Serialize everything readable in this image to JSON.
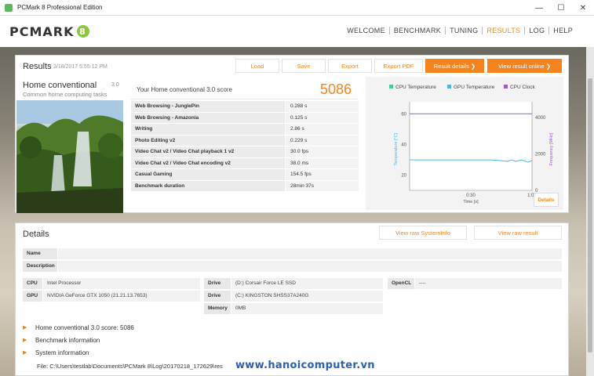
{
  "window": {
    "title": "PCMark 8 Professional Edition",
    "controls": [
      "—",
      "☐",
      "✕"
    ]
  },
  "header": {
    "logo_text": "PCMARK",
    "logo_badge": "8",
    "nav": [
      {
        "label": "WELCOME",
        "active": false
      },
      {
        "label": "BENCHMARK",
        "active": false
      },
      {
        "label": "TUNING",
        "active": false
      },
      {
        "label": "RESULTS",
        "active": true
      },
      {
        "label": "LOG",
        "active": false
      },
      {
        "label": "HELP",
        "active": false
      }
    ]
  },
  "results": {
    "title": "Results",
    "date": "2/18/2017 5:55:12 PM",
    "buttons": {
      "load": "Load",
      "save": "Save",
      "export": "Export",
      "export_pdf": "Export PDF",
      "result_details": "Result details ❯",
      "view_online": "View result online ❯"
    },
    "benchmark": {
      "name": "Home conventional",
      "version": "3.0",
      "subtitle": "Common home computing tasks"
    },
    "score": {
      "label": "Your Home conventional 3.0 score",
      "value": "5086"
    },
    "subscores": [
      {
        "name": "Web Browsing - JunglePin",
        "value": "0.288 s"
      },
      {
        "name": "Web Browsing - Amazonia",
        "value": "0.125 s"
      },
      {
        "name": "Writing",
        "value": "2.86 s"
      },
      {
        "name": "Photo Editing v2",
        "value": "0.229 s"
      },
      {
        "name": "Video Chat v2 / Video Chat playback 1 v2",
        "value": "30.0 fps"
      },
      {
        "name": "Video Chat v2 / Video Chat encoding v2",
        "value": "38.0 ms"
      },
      {
        "name": "Casual Gaming",
        "value": "154.5 fps"
      },
      {
        "name": "Benchmark duration",
        "value": "28min 37s"
      }
    ],
    "details_button": "Details"
  },
  "chart_data": {
    "type": "line",
    "legend_placement": "top",
    "xlabel": "Time [s]",
    "ylabel": "Temperature [°C]",
    "y2label": "Frequency [MHz]",
    "x_ticks": [
      "0:30",
      "1:00"
    ],
    "ylim": [
      10,
      65
    ],
    "y_ticks": [
      20,
      40,
      60
    ],
    "y2lim": [
      0,
      4600
    ],
    "y2_ticks": [
      0,
      2000,
      4000
    ],
    "grid": false,
    "colors": {
      "cpu_temp": "#48c7a3",
      "gpu_temp": "#4db6e6",
      "cpu_clock": "#9b59d0"
    },
    "series": [
      {
        "name": "CPU Temperature",
        "axis": "left",
        "x": [],
        "values": []
      },
      {
        "name": "GPU Temperature",
        "axis": "left",
        "x": [
          0,
          5,
          10,
          15,
          20,
          25,
          30,
          35,
          40,
          45,
          48,
          50,
          52,
          55,
          58,
          60
        ],
        "values": [
          30,
          30,
          30,
          30,
          30,
          30,
          30,
          30,
          30,
          29.5,
          29,
          30,
          29,
          30,
          28.5,
          29.5
        ]
      },
      {
        "name": "CPU Clock",
        "axis": "right",
        "x": [
          0,
          10,
          20,
          30,
          40,
          50,
          60
        ],
        "values": [
          4200,
          4200,
          4200,
          4200,
          4200,
          4200,
          4200
        ]
      }
    ]
  },
  "details": {
    "title": "Details",
    "view_systeminfo": "View raw SystemInfo",
    "view_result": "View raw result",
    "name_label": "Name",
    "name_value": "",
    "description_label": "Description",
    "description_value": "",
    "cpu_label": "CPU",
    "cpu_value": "Intel Processor",
    "gpu_label": "GPU",
    "gpu_value": "NVIDIA GeForce GTX 1050 (21.21.13.7653)",
    "drive1_label": "Drive",
    "drive1_value": "(D:) Corsair Force LE SSD",
    "drive2_label": "Drive",
    "drive2_value": "(C:) KINGSTON SHSS37A240G",
    "memory_label": "Memory",
    "memory_value": "0MB",
    "opencl_label": "OpenCL",
    "opencl_value": "----",
    "sections": [
      "Home conventional 3.0 score: 5086",
      "Benchmark information",
      "System information"
    ],
    "file_path": "File: C:\\Users\\testlab\\Documents\\PCMark 8\\Log\\20170218_172629\\res"
  },
  "watermark": "www.hanoicomputer.vn"
}
